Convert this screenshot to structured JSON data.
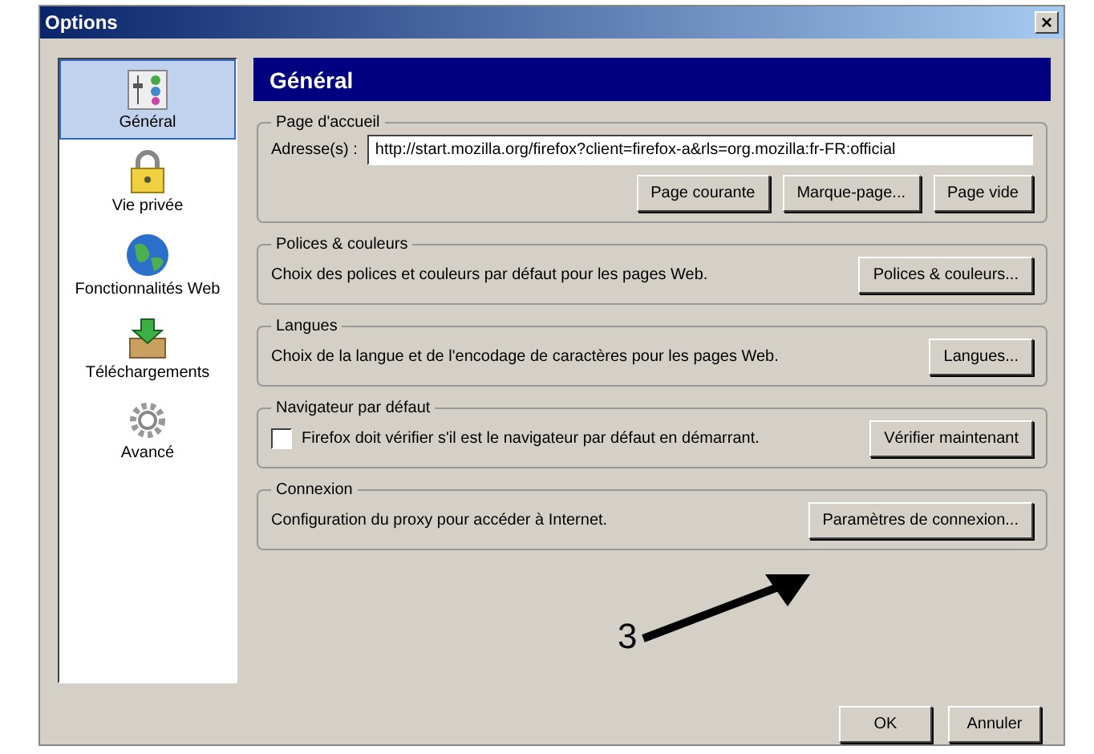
{
  "window": {
    "title": "Options",
    "close": "×"
  },
  "sidebar": {
    "items": [
      {
        "label": "Général",
        "kind": "panels",
        "selected": true
      },
      {
        "label": "Vie privée",
        "kind": "lock",
        "selected": false
      },
      {
        "label": "Fonctionnalités Web",
        "kind": "globe",
        "selected": false
      },
      {
        "label": "Téléchargements",
        "kind": "download",
        "selected": false
      },
      {
        "label": "Avancé",
        "kind": "gear",
        "selected": false
      }
    ]
  },
  "header": "Général",
  "groups": [
    {
      "title": "Page d'accueil",
      "kind": "address",
      "label": "Adresse(s) :",
      "value": "http://start.mozilla.org/firefox?client=firefox-a&rls=org.mozilla:fr-FR:official",
      "buttons": [
        "Page courante",
        "Marque-page...",
        "Page vide"
      ]
    },
    {
      "title": "Polices & couleurs",
      "kind": "text",
      "text": "Choix des polices et couleurs par défaut pour les pages Web.",
      "buttons": [
        "Polices & couleurs..."
      ]
    },
    {
      "title": "Langues",
      "kind": "text",
      "text": "Choix de la langue et de l'encodage de caractères pour les pages Web.",
      "buttons": [
        "Langues..."
      ]
    },
    {
      "title": "Navigateur par défaut",
      "kind": "checkbox",
      "text": "Firefox doit vérifier s'il est le navigateur par défaut en démarrant.",
      "checked": false,
      "buttons": [
        "Vérifier maintenant"
      ]
    },
    {
      "title": "Connexion",
      "kind": "text",
      "text": "Configuration du proxy pour accéder à Internet.",
      "buttons": [
        "Paramètres de connexion..."
      ]
    }
  ],
  "annotation": {
    "label": "3"
  },
  "footer": {
    "buttons": [
      "OK",
      "Annuler"
    ]
  }
}
